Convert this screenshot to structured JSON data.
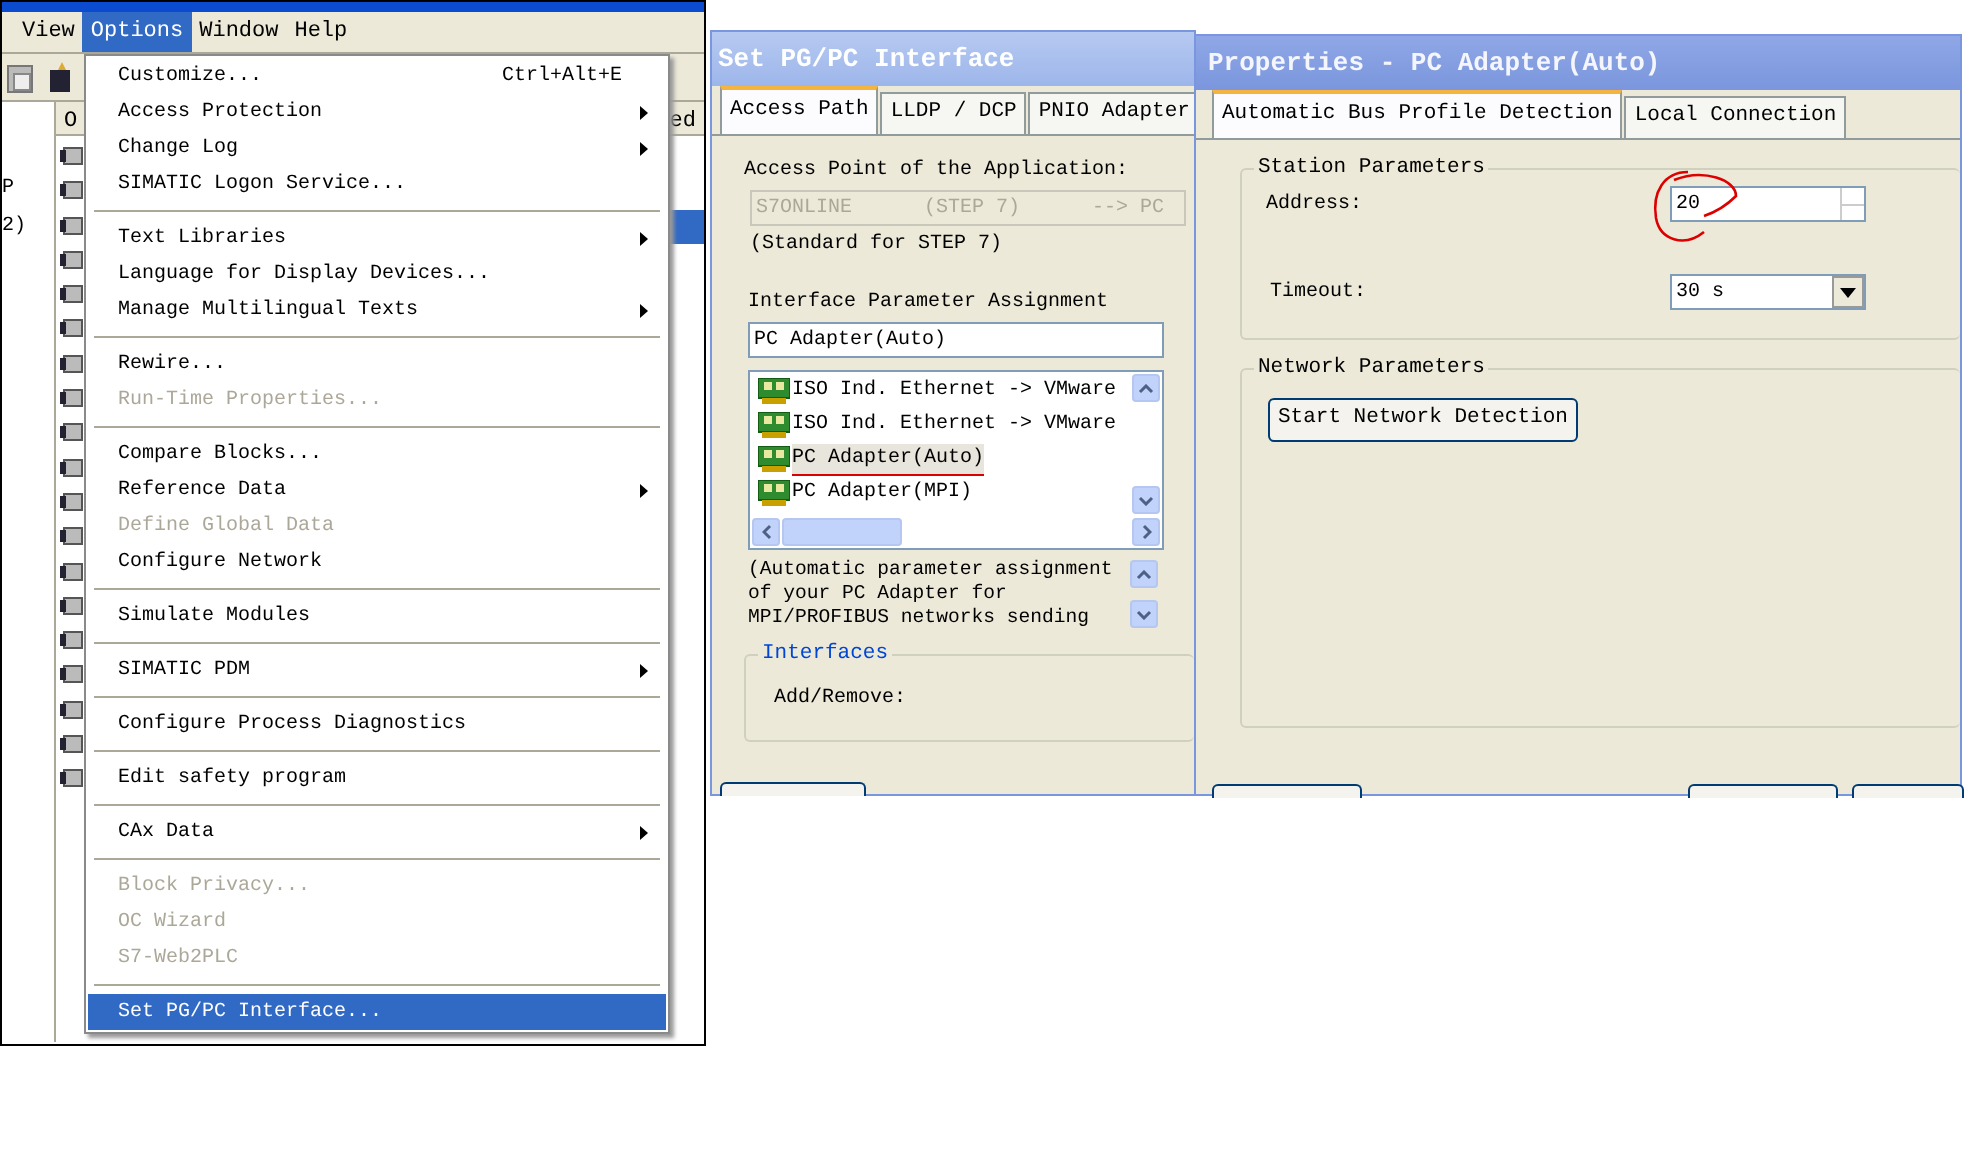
{
  "app": {
    "menubar": [
      {
        "label": "View",
        "selected": false
      },
      {
        "label": "Options",
        "selected": true
      },
      {
        "label": "Window",
        "selected": false
      },
      {
        "label": "Help",
        "selected": false
      }
    ],
    "tree_fragments": [
      "P",
      "2)"
    ],
    "list_header_fragments": [
      "O",
      "ed"
    ]
  },
  "menu": [
    {
      "kind": "item",
      "label": "Customize...",
      "shortcut": "Ctrl+Alt+E",
      "submenu": false,
      "disabled": false,
      "selected": false
    },
    {
      "kind": "item",
      "label": "Access Protection",
      "submenu": true,
      "disabled": false,
      "selected": false
    },
    {
      "kind": "item",
      "label": "Change Log",
      "submenu": true,
      "disabled": false,
      "selected": false
    },
    {
      "kind": "item",
      "label": "SIMATIC Logon Service...",
      "submenu": false,
      "disabled": false,
      "selected": false
    },
    {
      "kind": "separator"
    },
    {
      "kind": "item",
      "label": "Text Libraries",
      "submenu": true,
      "disabled": false,
      "selected": false
    },
    {
      "kind": "item",
      "label": "Language for Display Devices...",
      "submenu": false,
      "disabled": false,
      "selected": false
    },
    {
      "kind": "item",
      "label": "Manage Multilingual Texts",
      "submenu": true,
      "disabled": false,
      "selected": false
    },
    {
      "kind": "separator"
    },
    {
      "kind": "item",
      "label": "Rewire...",
      "submenu": false,
      "disabled": false,
      "selected": false
    },
    {
      "kind": "item",
      "label": "Run-Time Properties...",
      "submenu": false,
      "disabled": true,
      "selected": false
    },
    {
      "kind": "separator"
    },
    {
      "kind": "item",
      "label": "Compare Blocks...",
      "submenu": false,
      "disabled": false,
      "selected": false
    },
    {
      "kind": "item",
      "label": "Reference Data",
      "submenu": true,
      "disabled": false,
      "selected": false
    },
    {
      "kind": "item",
      "label": "Define Global Data",
      "submenu": false,
      "disabled": true,
      "selected": false
    },
    {
      "kind": "item",
      "label": "Configure Network",
      "submenu": false,
      "disabled": false,
      "selected": false
    },
    {
      "kind": "separator"
    },
    {
      "kind": "item",
      "label": "Simulate Modules",
      "submenu": false,
      "disabled": false,
      "selected": false
    },
    {
      "kind": "separator"
    },
    {
      "kind": "item",
      "label": "SIMATIC PDM",
      "submenu": true,
      "disabled": false,
      "selected": false
    },
    {
      "kind": "separator"
    },
    {
      "kind": "item",
      "label": "Configure Process Diagnostics",
      "submenu": false,
      "disabled": false,
      "selected": false
    },
    {
      "kind": "separator"
    },
    {
      "kind": "item",
      "label": "Edit safety program",
      "submenu": false,
      "disabled": false,
      "selected": false
    },
    {
      "kind": "separator"
    },
    {
      "kind": "item",
      "label": "CAx Data",
      "submenu": true,
      "disabled": false,
      "selected": false
    },
    {
      "kind": "separator"
    },
    {
      "kind": "item",
      "label": "Block Privacy...",
      "submenu": false,
      "disabled": true,
      "selected": false
    },
    {
      "kind": "item",
      "label": "OC Wizard",
      "submenu": false,
      "disabled": true,
      "selected": false
    },
    {
      "kind": "item",
      "label": "S7-Web2PLC",
      "submenu": false,
      "disabled": true,
      "selected": false
    },
    {
      "kind": "separator"
    },
    {
      "kind": "item",
      "label": "Set PG/PC Interface...",
      "submenu": false,
      "disabled": false,
      "selected": true
    }
  ],
  "pgpc_dialog": {
    "title": "Set PG/PC Interface",
    "tabs": [
      {
        "label": "Access Path",
        "selected": true
      },
      {
        "label": "LLDP / DCP",
        "selected": false
      },
      {
        "label": "PNIO Adapter",
        "selected": false
      }
    ],
    "access_point_label": "Access Point of the Application:",
    "access_point_value": "S7ONLINE      (STEP 7)      --> PC",
    "access_point_note": "(Standard for STEP 7)",
    "assignment_label": "Interface Parameter Assignment",
    "assignment_value": "PC Adapter(Auto)",
    "interfaces": [
      {
        "label": "ISO Ind. Ethernet -> VMware",
        "selected": false
      },
      {
        "label": "ISO Ind. Ethernet -> VMware",
        "selected": false
      },
      {
        "label": "PC Adapter(Auto)",
        "selected": true
      },
      {
        "label": "PC Adapter(MPI)",
        "selected": false
      }
    ],
    "description": "(Automatic parameter assignment of your PC Adapter for MPI/PROFIBUS networks sending",
    "interfaces_group": "Interfaces",
    "add_remove_label": "Add/Remove:"
  },
  "properties_dialog": {
    "title": "Properties - PC Adapter(Auto)",
    "tabs": [
      {
        "label": "Automatic Bus Profile Detection",
        "selected": true
      },
      {
        "label": "Local Connection",
        "selected": false
      }
    ],
    "station_group": "Station Parameters",
    "address_label": "Address:",
    "address_value": "20",
    "timeout_label": "Timeout:",
    "timeout_value": "30 s",
    "network_group": "Network Parameters",
    "detect_button": "Start Network Detection"
  }
}
